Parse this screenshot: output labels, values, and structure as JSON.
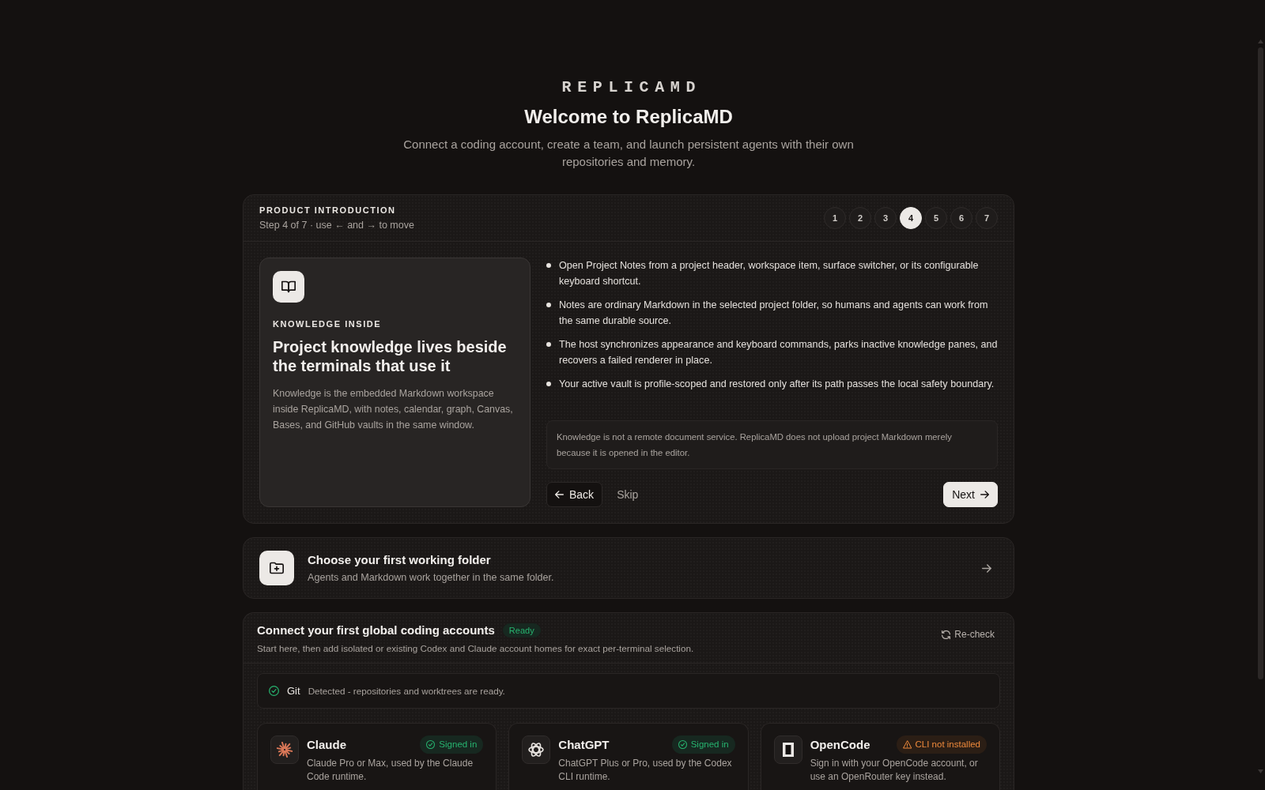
{
  "header": {
    "wordmark": "REPLICAMD",
    "title": "Welcome to ReplicaMD",
    "subtitle": "Connect a coding account, create a team, and launch persistent agents with their own repositories and memory."
  },
  "intro": {
    "eyebrow": "PRODUCT INTRODUCTION",
    "progress": "Step 4 of 7 · use ← and → to move",
    "steps": [
      {
        "label": "1",
        "selected": false
      },
      {
        "label": "2",
        "selected": false
      },
      {
        "label": "3",
        "selected": false
      },
      {
        "label": "4",
        "selected": true
      },
      {
        "label": "5",
        "selected": false
      },
      {
        "label": "6",
        "selected": false
      },
      {
        "label": "7",
        "selected": false
      }
    ],
    "feature": {
      "eyebrow": "KNOWLEDGE INSIDE",
      "title": "Project knowledge lives beside the terminals that use it",
      "description": "Knowledge is the embedded Markdown workspace inside ReplicaMD, with notes, calendar, graph, Canvas, Bases, and GitHub vaults in the same window."
    },
    "points": [
      "Open Project Notes from a project header, workspace item, surface switcher, or its configurable keyboard shortcut.",
      "Notes are ordinary Markdown in the selected project folder, so humans and agents can work from the same durable source.",
      "The host synchronizes appearance and keyboard commands, parks inactive knowledge panes, and recovers a failed renderer in place.",
      "Your active vault is profile-scoped and restored only after its path passes the local safety boundary."
    ],
    "note": "Knowledge is not a remote document service. ReplicaMD does not upload project Markdown merely because it is opened in the editor.",
    "actions": {
      "back": "Back",
      "skip": "Skip",
      "next": "Next"
    }
  },
  "folder": {
    "title": "Choose your first working folder",
    "subtitle": "Agents and Markdown work together in the same folder."
  },
  "accounts": {
    "title": "Connect your first global coding accounts",
    "status": {
      "text": "Ready",
      "kind": "ok"
    },
    "subtitle": "Start here, then add isolated or existing Codex and Claude account homes for exact per-terminal selection.",
    "recheck": "Re-check",
    "tools": [
      {
        "name": "Git",
        "description": "Detected - repositories and worktrees are ready.",
        "kind": "ok"
      }
    ],
    "providers": [
      {
        "name": "Claude",
        "status": {
          "text": "Signed in",
          "kind": "ok"
        },
        "description": "Claude Pro or Max, used by the Claude Code runtime."
      },
      {
        "name": "ChatGPT",
        "status": {
          "text": "Signed in",
          "kind": "ok"
        },
        "description": "ChatGPT Plus or Pro, used by the Codex CLI runtime."
      },
      {
        "name": "OpenCode",
        "status": {
          "text": "CLI not installed",
          "kind": "warning"
        },
        "description": "Sign in with your OpenCode account, or use an OpenRouter key instead."
      }
    ]
  }
}
